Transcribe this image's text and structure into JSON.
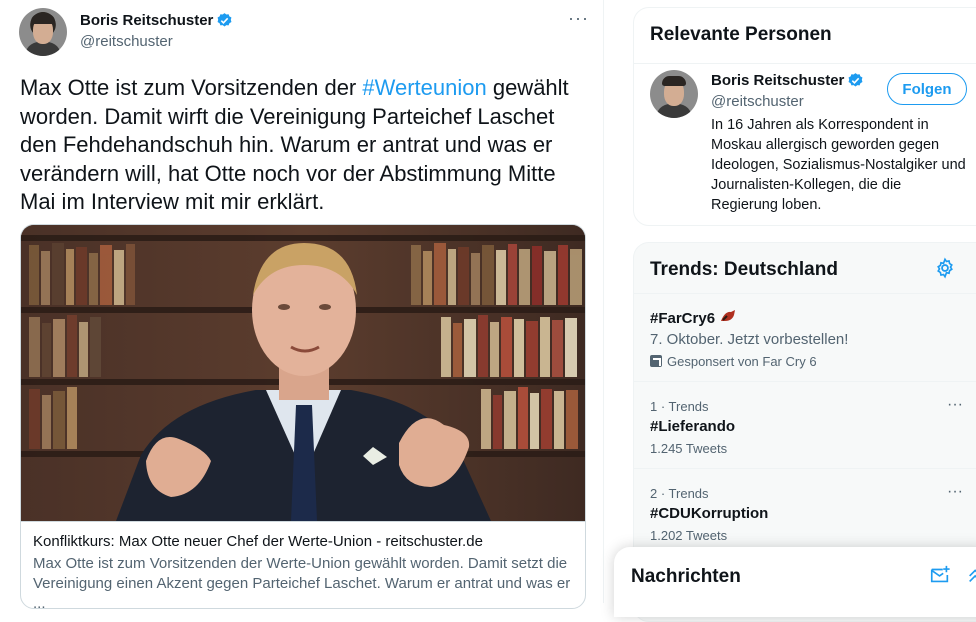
{
  "tweet": {
    "author_name": "Boris Reitschuster",
    "author_handle": "@reitschuster",
    "more_label": "···",
    "text_before": "Max Otte ist zum Vorsitzenden der ",
    "hashtag": "#Werteunion",
    "text_after": " gewählt worden. Damit wirft die Vereinigung Parteichef Laschet den Fehdehandschuh hin. Warum er antrat und was er verändern will, hat Otte noch vor der Abstimmung Mitte Mai im Interview mit mir erklärt.",
    "card": {
      "title": "Konfliktkurs: Max Otte neuer Chef der Werte-Union - reitschuster.de",
      "description": "Max Otte ist zum Vorsitzenden der Werte-Union gewählt worden. Damit setzt die Vereinigung einen Akzent gegen Parteichef Laschet. Warum er antrat und was er ..."
    }
  },
  "relevant_people": {
    "heading": "Relevante Personen",
    "name": "Boris Reitschuster",
    "handle": "@reitschuster",
    "follow_label": "Folgen",
    "bio": "In 16 Jahren als Korrespondent in Moskau allergisch geworden gegen Ideologen, Sozialismus-Nostalgiker und Journalisten-Kollegen, die die Regierung loben."
  },
  "trends": {
    "heading": "Trends: Deutschland",
    "items": [
      {
        "name": "#FarCry6",
        "subtitle": "7. Oktober. Jetzt vorbestellen!",
        "promoted": "Gesponsert von Far Cry 6"
      },
      {
        "context": "1 · Trends",
        "name": "#Lieferando",
        "count": "1.245 Tweets",
        "more": "···"
      },
      {
        "context": "2 · Trends",
        "name": "#CDUKorruption",
        "count": "1.202 Tweets",
        "more": "···"
      }
    ]
  },
  "messages": {
    "title": "Nachrichten"
  },
  "colors": {
    "accent": "#1d9bf0",
    "text": "#0f1419",
    "secondary": "#536471"
  }
}
